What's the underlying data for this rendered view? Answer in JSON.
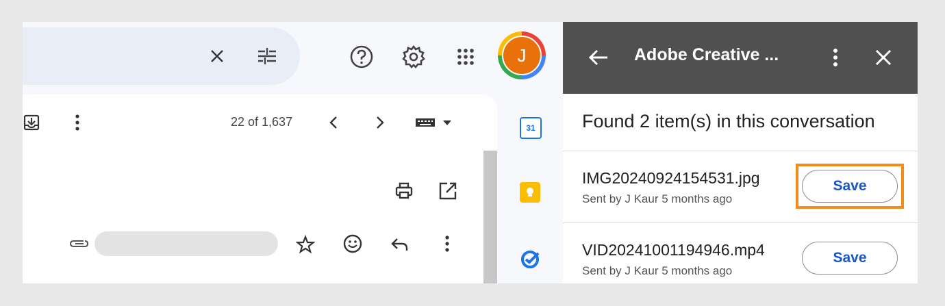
{
  "gmail": {
    "search": {
      "clear_icon": "close-icon",
      "options_icon": "tune-icon"
    },
    "topbar": {
      "help_icon": "help-icon",
      "settings_icon": "gear-icon",
      "apps_icon": "apps-grid-icon",
      "avatar_initial": "J"
    },
    "toolbar": {
      "page_count": "22 of 1,637"
    }
  },
  "side_apps": [
    {
      "name": "calendar",
      "label": "31",
      "color": "#1a73e8"
    },
    {
      "name": "keep",
      "color": "#fbbc04"
    },
    {
      "name": "tasks",
      "color": "#1a73e8"
    }
  ],
  "panel": {
    "title": "Adobe Creative ...",
    "found_text": "Found 2 item(s) in this conversation",
    "items": [
      {
        "file": "IMG20240924154531.jpg",
        "meta": "Sent by J Kaur 5 months ago",
        "action": "Save"
      },
      {
        "file": "VID20241001194946.mp4",
        "meta": "Sent by J Kaur 5 months ago",
        "action": "Save"
      }
    ]
  },
  "colors": {
    "panel_header": "#505050",
    "save_text": "#1a56c4",
    "highlight": "#f28c1c",
    "avatar": "#e8710a"
  }
}
